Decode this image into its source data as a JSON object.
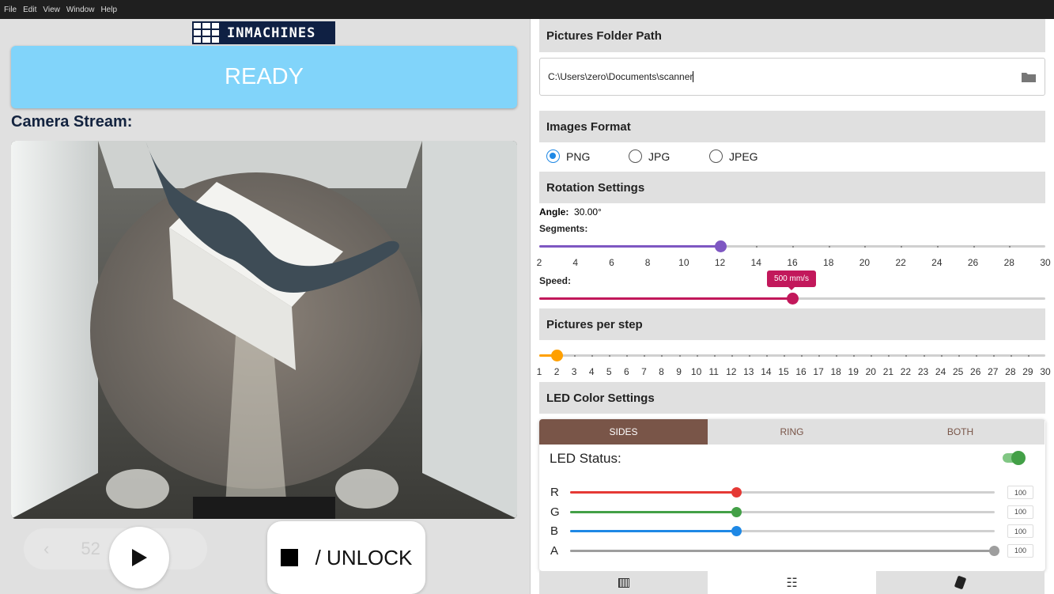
{
  "menubar": [
    "File",
    "Edit",
    "View",
    "Window",
    "Help"
  ],
  "logo": "INMACHINES",
  "status": "READY",
  "camera_label": "Camera Stream:",
  "pager": {
    "prev": "‹",
    "value": "52",
    "next": "›",
    "more": "⋮"
  },
  "controls": {
    "play": "▶",
    "unlock_label": "/ UNLOCK"
  },
  "settings": {
    "folder_title": "Pictures Folder Path",
    "folder_value": "C:\\Users\\zero\\Documents\\scanner",
    "format_title": "Images Format",
    "formats": [
      {
        "label": "PNG",
        "selected": true
      },
      {
        "label": "JPG",
        "selected": false
      },
      {
        "label": "JPEG",
        "selected": false
      }
    ],
    "rotation_title": "Rotation Settings",
    "angle_label": "Angle:",
    "angle_value": "30.00°",
    "segments_label": "Segments:",
    "segments": {
      "min": 2,
      "max": 30,
      "value": 12,
      "color": "#7e57c2",
      "ticks": [
        "2",
        "4",
        "6",
        "8",
        "10",
        "12",
        "14",
        "16",
        "18",
        "20",
        "22",
        "24",
        "26",
        "28",
        "30"
      ]
    },
    "speed_label": "Speed:",
    "speed": {
      "fraction": 0.5,
      "tooltip": "500 mm/s",
      "color": "#c2185b"
    },
    "pps_title": "Pictures per step",
    "pps": {
      "min": 1,
      "max": 30,
      "value": 2,
      "color": "#ffa000",
      "ticks": [
        "1",
        "2",
        "3",
        "4",
        "5",
        "6",
        "7",
        "8",
        "9",
        "10",
        "11",
        "12",
        "13",
        "14",
        "15",
        "16",
        "17",
        "18",
        "19",
        "20",
        "21",
        "22",
        "23",
        "24",
        "25",
        "26",
        "27",
        "28",
        "29",
        "30"
      ]
    },
    "led_title": "LED Color Settings",
    "led_tabs": [
      "SIDES",
      "RING",
      "BOTH"
    ],
    "led_status_label": "LED Status:",
    "led_on": true,
    "channels": [
      {
        "name": "R",
        "value": "100",
        "fraction": 0.392,
        "color": "#e53935"
      },
      {
        "name": "G",
        "value": "100",
        "fraction": 0.392,
        "color": "#43a047"
      },
      {
        "name": "B",
        "value": "100",
        "fraction": 0.392,
        "color": "#1e88e5"
      },
      {
        "name": "A",
        "value": "100",
        "fraction": 1.0,
        "color": "#9e9e9e"
      }
    ]
  },
  "bottom_tabs": [
    "gradient-icon",
    "sliders-icon",
    "cards-icon"
  ]
}
